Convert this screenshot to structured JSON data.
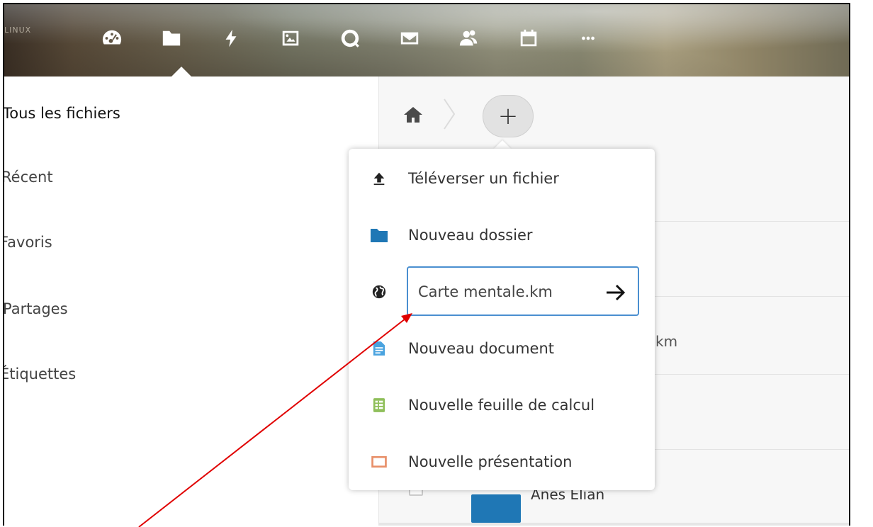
{
  "header": {
    "logo_text": "LINUX",
    "nav": [
      {
        "name": "dashboard",
        "icon": "speedometer-icon"
      },
      {
        "name": "files",
        "icon": "folder-icon",
        "active": true
      },
      {
        "name": "activity",
        "icon": "lightning-icon"
      },
      {
        "name": "gallery",
        "icon": "image-icon"
      },
      {
        "name": "talk",
        "icon": "search-icon"
      },
      {
        "name": "mail",
        "icon": "envelope-icon"
      },
      {
        "name": "contacts",
        "icon": "people-icon"
      },
      {
        "name": "calendar",
        "icon": "calendar-icon"
      },
      {
        "name": "more",
        "icon": "more-dots-icon"
      }
    ]
  },
  "sidebar": {
    "items": [
      {
        "label": "Tous les fichiers",
        "active": true
      },
      {
        "label": "Récent"
      },
      {
        "label": "Favoris"
      },
      {
        "label": "Partages"
      },
      {
        "label": "Étiquettes"
      }
    ]
  },
  "main": {
    "add_label": "+",
    "partial_text": "km",
    "row_name": "Anes Elian"
  },
  "menu": {
    "upload_label": "Téléverser un fichier",
    "new_folder_label": "Nouveau dossier",
    "name_input_value": "Carte mentale.km",
    "new_document_label": "Nouveau document",
    "new_spreadsheet_label": "Nouvelle feuille de calcul",
    "new_presentation_label": "Nouvelle présentation"
  },
  "colors": {
    "accent": "#4a8fd0",
    "folder": "#1f77b5",
    "document": "#4aa3df",
    "spreadsheet": "#8fbf5a",
    "presentation": "#e8906a",
    "annotation": "#e00000"
  }
}
